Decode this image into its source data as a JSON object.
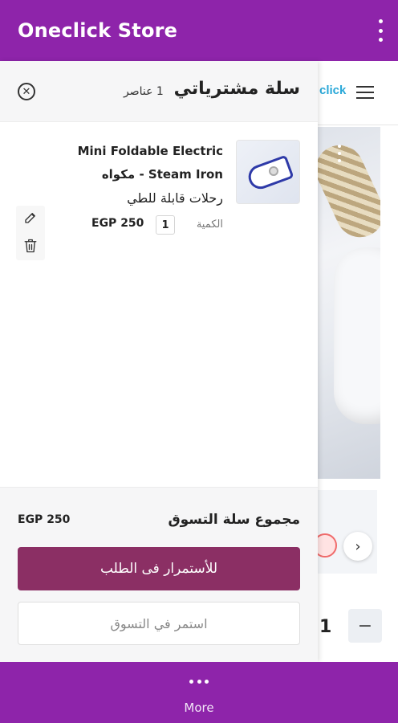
{
  "appbar": {
    "title": "Oneclick Store",
    "menu_icon": "more-vertical-icon"
  },
  "background_page": {
    "logo_fragment": "click",
    "quantity_value": "1",
    "minus_label": "−",
    "next_label": "›"
  },
  "cart": {
    "title": "سلة مشترياتي",
    "item_count": "1 عناصر",
    "close_icon": "close-circle-icon",
    "items": [
      {
        "name_line_1": "Mini Foldable Electric",
        "name_line_2": "مكواه - Steam Iron",
        "name_line_3": "رحلات قابلة للطي",
        "quantity_label": "الكمية",
        "quantity": "1",
        "price": "EGP 250",
        "edit_icon": "pencil-icon",
        "delete_icon": "trash-icon"
      }
    ],
    "subtotal_label": "مجموع سلة التسوق",
    "subtotal_value": "EGP 250",
    "checkout_label": "للأستمرار فى الطلب",
    "continue_label": "استمر في التسوق",
    "colors": {
      "checkout": "#8b2f64",
      "bar": "#8e24aa"
    }
  },
  "bottombar": {
    "more_label": "More",
    "more_icon": "more-horizontal-icon"
  }
}
